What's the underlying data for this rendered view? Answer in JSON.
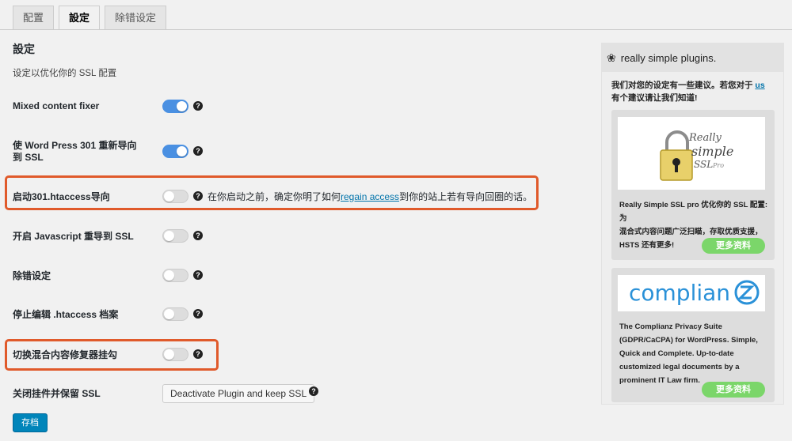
{
  "tabs": [
    {
      "label": "配置",
      "active": false
    },
    {
      "label": "設定",
      "active": true
    },
    {
      "label": "除错设定",
      "active": false
    }
  ],
  "page": {
    "title": "設定",
    "subtitle": "设定以优化你的 SSL 配置"
  },
  "settings": [
    {
      "label_line1": "Mixed content fixer",
      "label_line2": "",
      "enabled": true
    },
    {
      "label_line1": "使 Word Press 301 重新导向",
      "label_line2": "到 SSL",
      "enabled": true
    },
    {
      "label_line1": "启动301.htaccess导向",
      "label_line2": "",
      "enabled": false,
      "note_before": "在你启动之前，确定你明了如何",
      "note_link": "regain access",
      "note_after": "到你的站上若有导向回圈的话。"
    },
    {
      "label_line1": "开启 Javascript 重导到 SSL",
      "label_line2": "",
      "enabled": false
    },
    {
      "label_line1": "除错设定",
      "label_line2": "",
      "enabled": false
    },
    {
      "label_line1": "停止编辑 .htaccess 档案",
      "label_line2": "",
      "enabled": false
    },
    {
      "label_line1": "切换混合内容修复器挂勾",
      "label_line2": "",
      "enabled": false
    },
    {
      "label_line1": "关闭挂件并保留 SSL",
      "label_line2": ""
    }
  ],
  "help_icon": "?",
  "deactivate_button": "Deactivate Plugin and keep SSL",
  "save_button": "存档",
  "sidebar": {
    "brand": "really simple plugins.",
    "brand_icon": "leaf-icon",
    "intro_before": "我们对您的设定有一些建议。若您对于",
    "intro_link": "us",
    "intro_after": "有个建议请让我们知道!",
    "cards": [
      {
        "logo_text_1": "Really",
        "logo_text_2": "simple",
        "logo_text_3": "SSL",
        "logo_text_4": "Pro",
        "desc_line1": "Really Simple SSL pro 优化你的 SSL 配置: 为",
        "desc_line2": "混合式内容问题广泛扫瞄，存取优质支援，",
        "desc_line3": "HSTS 还有更多!",
        "more": "更多资料"
      },
      {
        "logo_text": "complian",
        "desc_line1": "The Complianz Privacy Suite",
        "desc_line2": "(GDPR/CaCPA) for WordPress. Simple,",
        "desc_line3": "Quick and Complete. Up-to-date",
        "desc_line4": "customized legal documents by a",
        "desc_line5": "prominent IT Law firm.",
        "more": "更多资料"
      }
    ]
  },
  "colors": {
    "toggle_on": "#4a90e2",
    "highlight_box": "#e05a2b",
    "save_button": "#0085ba",
    "more_button": "#7bd66a",
    "complianz_blue": "#2a91d8"
  }
}
